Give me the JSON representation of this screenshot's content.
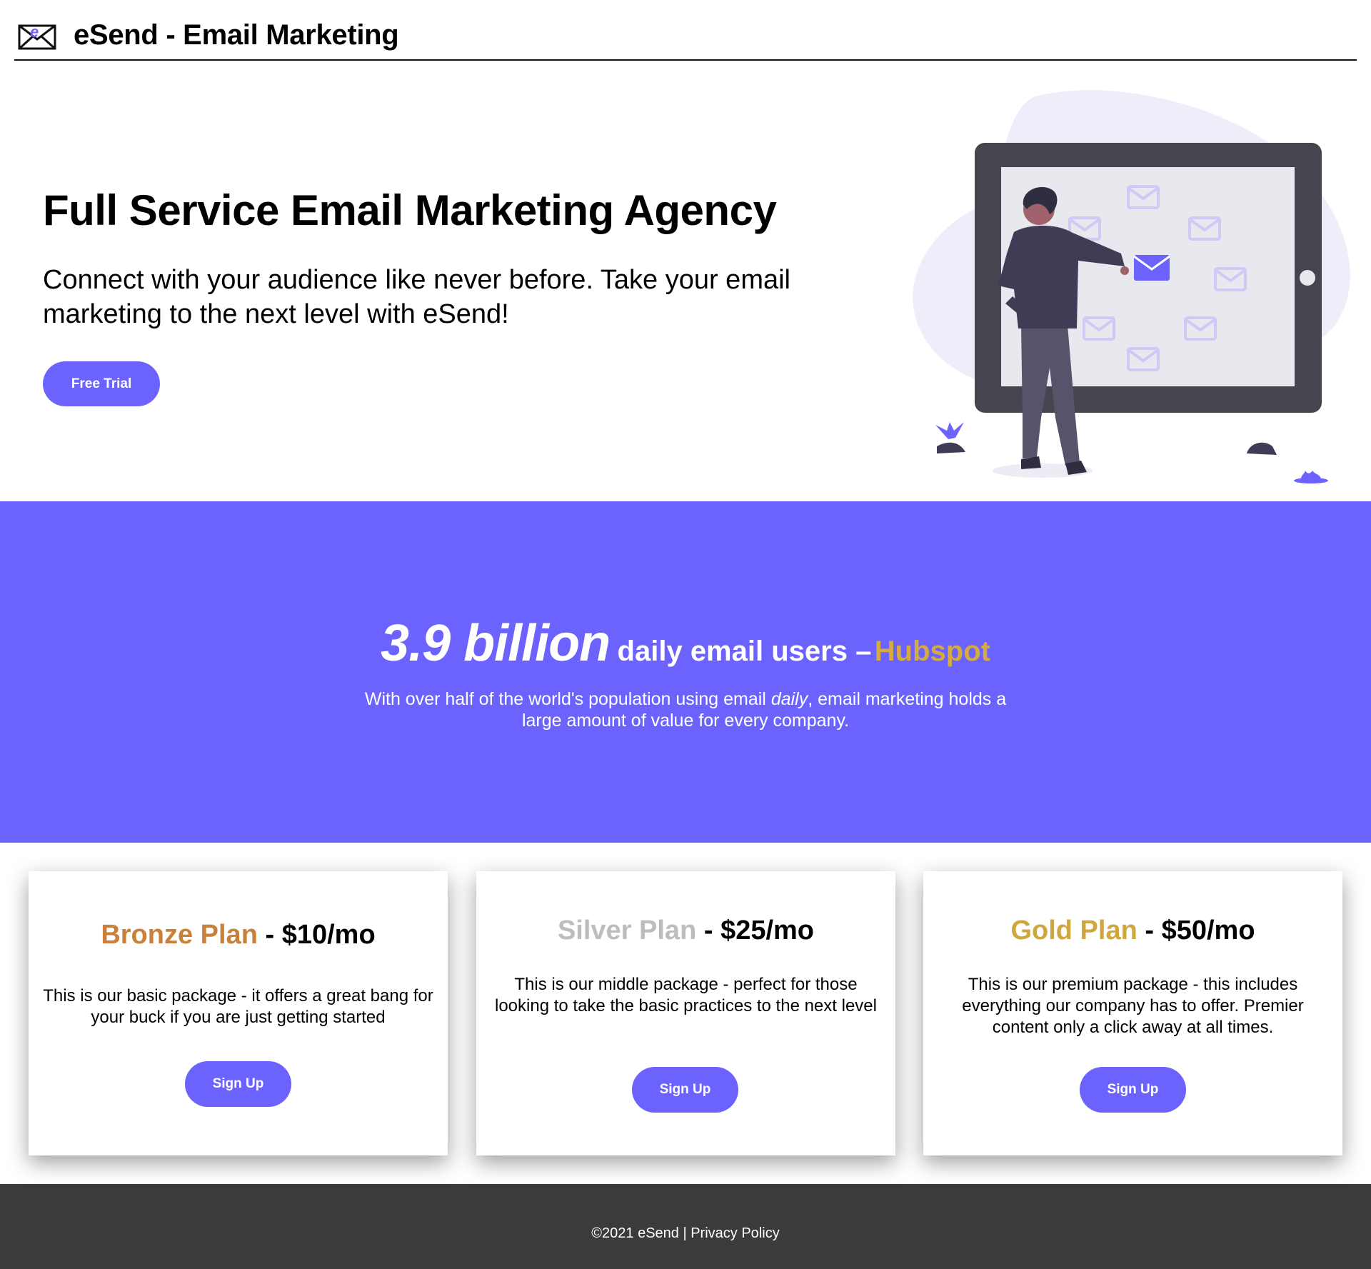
{
  "header": {
    "brand": "eSend - Email Marketing",
    "logo_icon": "envelope-e-logo-icon"
  },
  "hero": {
    "title": "Full Service Email Marketing Agency",
    "subtitle": "Connect with your audience like never before. Take your email marketing to the next level with eSend!",
    "cta_label": "Free Trial",
    "illustration": "man-sorting-emails-on-tablet-illustration"
  },
  "stats": {
    "number": "3.9 billion",
    "label": "daily email users –",
    "source": "Hubspot",
    "desc_before": "With over half of the world's population using email ",
    "desc_emphasis": "daily",
    "desc_after": ", email marketing holds a large amount of value for every company."
  },
  "plans": [
    {
      "name": "Bronze Plan",
      "separator": " - ",
      "price": "$10/mo",
      "description": "This is our basic package - it offers a great bang for your buck if you are just getting started",
      "button_label": "Sign Up",
      "color": "#c8803a"
    },
    {
      "name": "Silver Plan",
      "separator": " - ",
      "price": "$25/mo",
      "description": "This is our middle package - perfect for those looking to take the basic practices to the next level",
      "button_label": "Sign Up",
      "color": "#bdbdbd"
    },
    {
      "name": "Gold Plan",
      "separator": " - ",
      "price": "$50/mo",
      "description": "This is our premium package - this includes everything our company has to offer. Premier content only a click away at all times.",
      "button_label": "Sign Up",
      "color": "#cfa73c"
    }
  ],
  "footer": {
    "copyright": "©2021 eSend",
    "divider": " | ",
    "privacy_link": "Privacy Policy"
  },
  "colors": {
    "accent": "#6c63ff",
    "footer_bg": "#3b3b3b",
    "source_gold": "#d4aa45"
  }
}
